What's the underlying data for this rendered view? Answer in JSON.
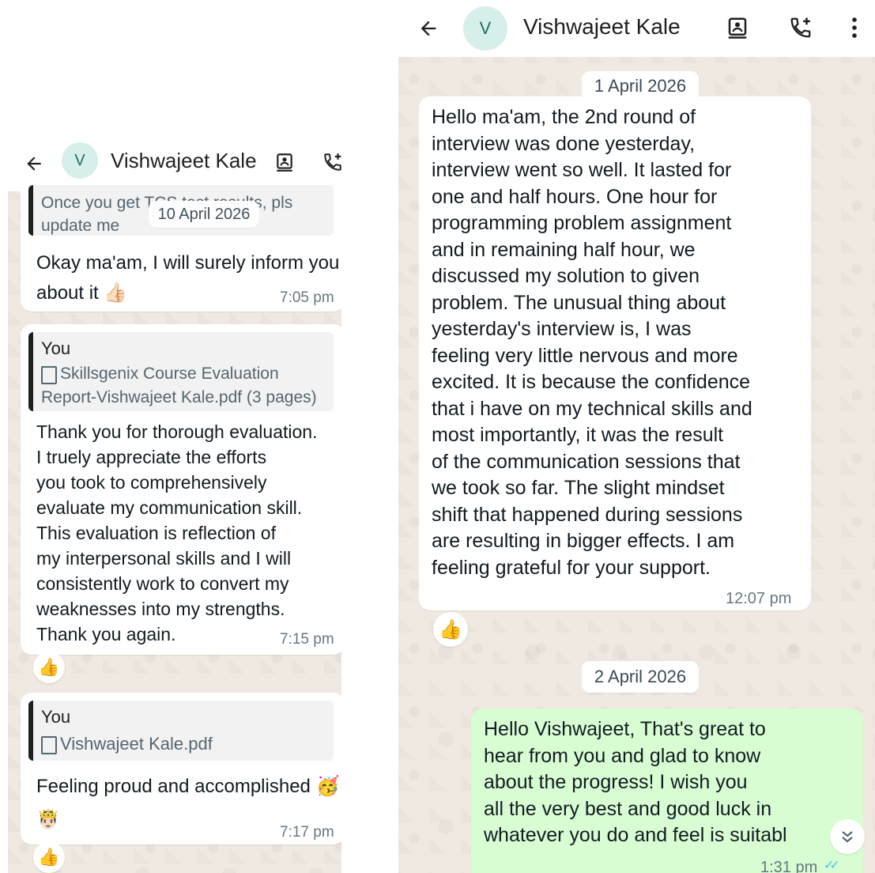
{
  "left": {
    "header": {
      "avatar_letter": "V",
      "contact_name": "Vishwajeet Kale"
    },
    "date_chip": "10 April 2026",
    "messages": [
      {
        "quoted_text": "Once you get TCS test results, pls\nupdate me"
      },
      {
        "text": "Okay ma'am, I will surely inform you\nabout it 👍🏻",
        "time": "7:05 pm"
      },
      {
        "quoted_sender": "You",
        "quoted_doc": "Skillsgenix Course Evaluation\nReport-Vishwajeet Kale.pdf (3 pages)",
        "text": "Thank you for thorough evaluation.\nI truely appreciate the efforts\nyou took to comprehensively\nevaluate my communication skill.\nThis evaluation is reflection of\nmy interpersonal skills and I will\nconsistently work to convert my\nweaknesses into my strengths.\nThank you again.",
        "time": "7:15 pm",
        "reaction": "👍"
      },
      {
        "quoted_sender": "You",
        "quoted_doc": "Vishwajeet Kale.pdf",
        "text": "Feeling proud and accomplished 🥳\n🤴🏻",
        "time": "7:17 pm",
        "reaction": "👍"
      }
    ]
  },
  "right": {
    "header": {
      "avatar_letter": "V",
      "contact_name": "Vishwajeet Kale"
    },
    "date_chip_1": "1 April 2026",
    "incoming": {
      "text": "Hello ma'am, the 2nd round of\ninterview was done yesterday,\ninterview went so well. It lasted for\none and half hours. One hour for\nprogramming problem assignment\nand in remaining half hour, we\ndiscussed my solution to given\nproblem. The unusual thing about\nyesterday's interview is, I was\nfeeling very little nervous and more\nexcited. It is because the confidence\nthat i have on my technical skills and\nmost importantly, it was the result\nof the communication sessions that\nwe took so far. The slight mindset\nshift that happened during sessions\nare resulting in bigger effects. I am\nfeeling grateful for your support.",
      "time": "12:07 pm",
      "reaction": "👍"
    },
    "date_chip_2": "2 April 2026",
    "outgoing": {
      "text": "Hello Vishwajeet, That's great to\nhear from you and glad to know\nabout the progress! I wish you\nall the very best and good luck in\nwhatever you do and feel is suitabl",
      "time": "1:31 pm",
      "status": "✓✓"
    }
  },
  "colors": {
    "incoming_bubble": "#ffffff",
    "outgoing_bubble": "#d9fdd3",
    "chat_background": "#efe9e1",
    "read_ticks": "#53bdeb"
  }
}
